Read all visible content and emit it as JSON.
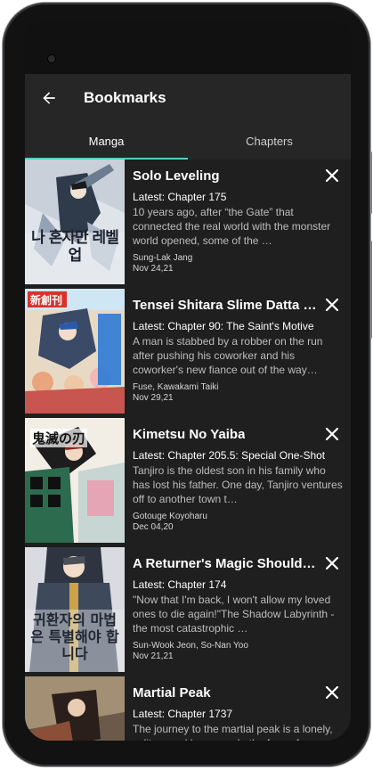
{
  "header": {
    "title": "Bookmarks",
    "back_icon": "arrow-left-icon"
  },
  "tabs": [
    {
      "label": "Manga",
      "active": true
    },
    {
      "label": "Chapters",
      "active": false
    }
  ],
  "accent_color": "#4fd1c5",
  "bookmarks": [
    {
      "title": "Solo Leveling",
      "latest": "Latest: Chapter 175",
      "description": "10 years ago, after “the Gate” that connected the real world with the monster world opened, some of the …",
      "author": "Sung-Lak Jang",
      "date": "Nov 24,21",
      "cover_caption": "나 혼자만 레벨업"
    },
    {
      "title": "Tensei Shitara Slime Datta Ken",
      "latest": "Latest: Chapter 90: The Saint's Motive",
      "description": "A man is stabbed by a robber on the run after pushing his coworker and his coworker's new fiance out of the way…",
      "author": "Fuse, Kawakami Taiki",
      "date": "Nov 29,21",
      "cover_caption": "新創刊"
    },
    {
      "title": "Kimetsu No Yaiba",
      "latest": "Latest: Chapter 205.5: Special One-Shot",
      "description": "Tanjiro is the oldest son in his family who has lost his father. One day, Tanjiro ventures off to another town t…",
      "author": "Gotouge Koyoharu",
      "date": "Dec 04,20",
      "cover_caption": "鬼滅の刃"
    },
    {
      "title": "A Returner's Magic Should Be Special",
      "latest": "Latest: Chapter 174",
      "description": "\"Now that I'm back, I won't allow my loved ones to die again!\"The Shadow Labyrinth - the most catastrophic …",
      "author": "Sun-Wook Jeon, So-Nan Yoo",
      "date": "Nov 21,21",
      "cover_caption": "귀환자의 마법은 특별해야 합니다"
    },
    {
      "title": "Martial Peak",
      "latest": "Latest: Chapter 1737",
      "description": "The journey to the martial peak is a lonely, solitary and long one. In the face of adversity, you must survive and remain unyielding.",
      "author": "",
      "date": "",
      "cover_caption": ""
    }
  ]
}
